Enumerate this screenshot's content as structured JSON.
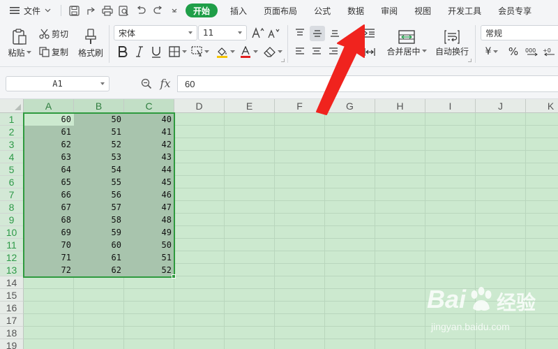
{
  "menubar": {
    "file_label": "文件",
    "tabs": [
      {
        "label": "开始",
        "active": true
      },
      {
        "label": "插入",
        "active": false
      },
      {
        "label": "页面布局",
        "active": false
      },
      {
        "label": "公式",
        "active": false
      },
      {
        "label": "数据",
        "active": false
      },
      {
        "label": "审阅",
        "active": false
      },
      {
        "label": "视图",
        "active": false
      },
      {
        "label": "开发工具",
        "active": false
      },
      {
        "label": "会员专享",
        "active": false
      }
    ]
  },
  "ribbon": {
    "paste": "粘贴",
    "cut": "剪切",
    "copy": "复制",
    "format_painter": "格式刷",
    "font_name": "宋体",
    "font_size": "11",
    "merge_center": "合并居中",
    "wrap_text": "自动换行",
    "number_format": "常规",
    "currency_symbol": "¥",
    "percent_symbol": "%"
  },
  "formula_bar": {
    "name_box": "A1",
    "fx": "fx",
    "value": "60"
  },
  "sheet": {
    "columns": [
      "A",
      "B",
      "C",
      "D",
      "E",
      "F",
      "G",
      "H",
      "I",
      "J",
      "K"
    ],
    "rows": [
      "1",
      "2",
      "3",
      "4",
      "5",
      "6",
      "7",
      "8",
      "9",
      "10",
      "11",
      "12",
      "13",
      "14",
      "15",
      "16",
      "17",
      "18",
      "19"
    ],
    "data": [
      [
        "60",
        "50",
        "40"
      ],
      [
        "61",
        "51",
        "41"
      ],
      [
        "62",
        "52",
        "42"
      ],
      [
        "63",
        "53",
        "43"
      ],
      [
        "64",
        "54",
        "44"
      ],
      [
        "65",
        "55",
        "45"
      ],
      [
        "66",
        "56",
        "46"
      ],
      [
        "67",
        "57",
        "47"
      ],
      [
        "68",
        "58",
        "48"
      ],
      [
        "69",
        "59",
        "49"
      ],
      [
        "70",
        "60",
        "50"
      ],
      [
        "71",
        "61",
        "51"
      ],
      [
        "72",
        "62",
        "52"
      ]
    ],
    "selection": "A1:C13",
    "grid_color": "#cce9cf",
    "selection_color": "#2e9a3e"
  },
  "watermark": {
    "brand": "Bai",
    "brand_suffix": "经验",
    "url": "jingyan.baidu.com"
  },
  "annotation": {
    "arrow_color": "#f0231e",
    "points_to": "数据"
  }
}
